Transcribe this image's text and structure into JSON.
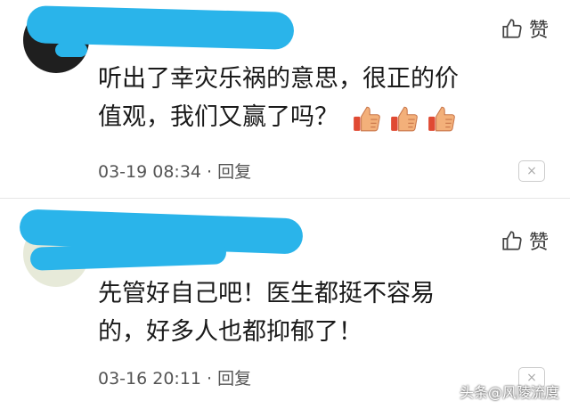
{
  "comments": [
    {
      "like_label": "赞",
      "text_line1": "听出了幸灾乐祸的意思，很正的价",
      "text_line2": "值观，我们又赢了吗？",
      "emoji_icons": [
        "thumbs-up-emoji",
        "thumbs-up-emoji",
        "thumbs-up-emoji"
      ],
      "timestamp": "03-19 08:34",
      "separator": " · ",
      "reply_label": "回复",
      "close_label": "×"
    },
    {
      "like_label": "赞",
      "text_line1": "先管好自己吧！医生都挺不容易",
      "text_line2": "的，好多人也都抑郁了！",
      "timestamp": "03-16 20:11",
      "separator": " · ",
      "reply_label": "回复",
      "close_label": "×"
    }
  ],
  "watermark": "头条@风陵流度",
  "colors": {
    "redaction": "#2ab4ea",
    "emoji_fill": "#f3b07a",
    "emoji_cuff": "#e04a33"
  }
}
